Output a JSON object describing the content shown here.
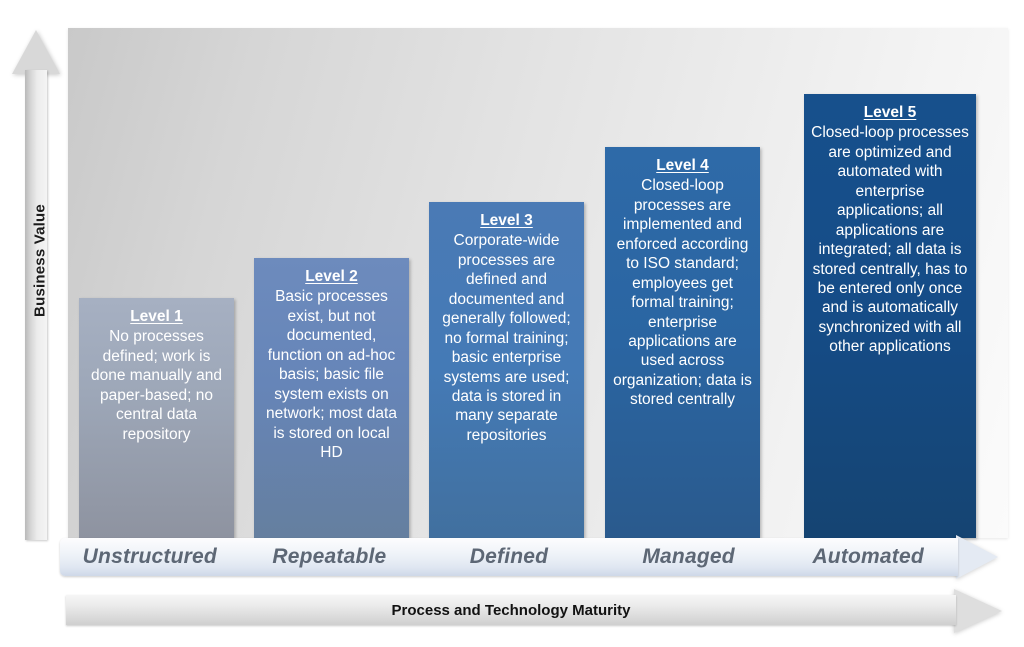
{
  "chart_data": {
    "type": "bar",
    "title": "",
    "xlabel": "Process and Technology Maturity",
    "ylabel": "Business Value",
    "categories": [
      "Unstructured",
      "Repeatable",
      "Defined",
      "Managed",
      "Automated"
    ],
    "values": [
      1,
      2,
      3,
      4,
      5
    ],
    "ylim": [
      0,
      5
    ],
    "grid": false,
    "legend": "none",
    "series": [
      {
        "name": "Maturity Level",
        "values": [
          1,
          2,
          3,
          4,
          5
        ]
      }
    ],
    "bar_colors": [
      "#9da7b8",
      "#6685b8",
      "#4a7ab5",
      "#2a65a2",
      "#17508c"
    ],
    "annotations": [
      "Level 1 No processes defined; work is done manually and paper-based; no central data repository",
      "Level 2 Basic processes exist, but not documented, function on ad-hoc basis; basic file system exists on network; most data is stored on local HD",
      "Level 3 Corporate-wide processes are defined and documented and generally followed; no formal training; basic enterprise systems are used; data is stored in many separate repositories",
      "Level 4 Closed-loop processes are implemented and enforced according to ISO standard; employees get formal training; enterprise applications are used across organization; data is stored centrally",
      "Level 5 Closed-loop processes are optimized and automated with enterprise applications; all applications are integrated; all data is stored centrally, has to be entered only once and is automatically synchronized with all other applications"
    ]
  },
  "axes": {
    "vertical_label": "Business Value",
    "horizontal_label": "Process and Technology Maturity"
  },
  "bars": [
    {
      "level": "Level 1",
      "stage": "Unstructured",
      "description": "No processes defined; work is done manually and paper-based; no central data repository",
      "color": "#9da7b8"
    },
    {
      "level": "Level 2",
      "stage": "Repeatable",
      "description": "Basic processes exist, but not documented, function on ad-hoc basis; basic file system exists on network; most data is stored on local HD",
      "color": "#6685b8"
    },
    {
      "level": "Level 3",
      "stage": "Defined",
      "description": "Corporate-wide processes are defined and documented and generally followed; no formal training; basic enterprise systems are used; data is stored in many separate repositories",
      "color": "#4a7ab5"
    },
    {
      "level": "Level 4",
      "stage": "Managed",
      "description": "Closed-loop processes are implemented and enforced according to ISO standard; employees get formal training; enterprise applications are used across organization; data is stored centrally",
      "color": "#2a65a2"
    },
    {
      "level": "Level 5",
      "stage": "Automated",
      "description": "Closed-loop processes are optimized and automated with enterprise applications; all applications are integrated; all data is stored centrally, has to be entered only once and is automatically synchronized with all other applications",
      "color": "#17508c"
    }
  ]
}
